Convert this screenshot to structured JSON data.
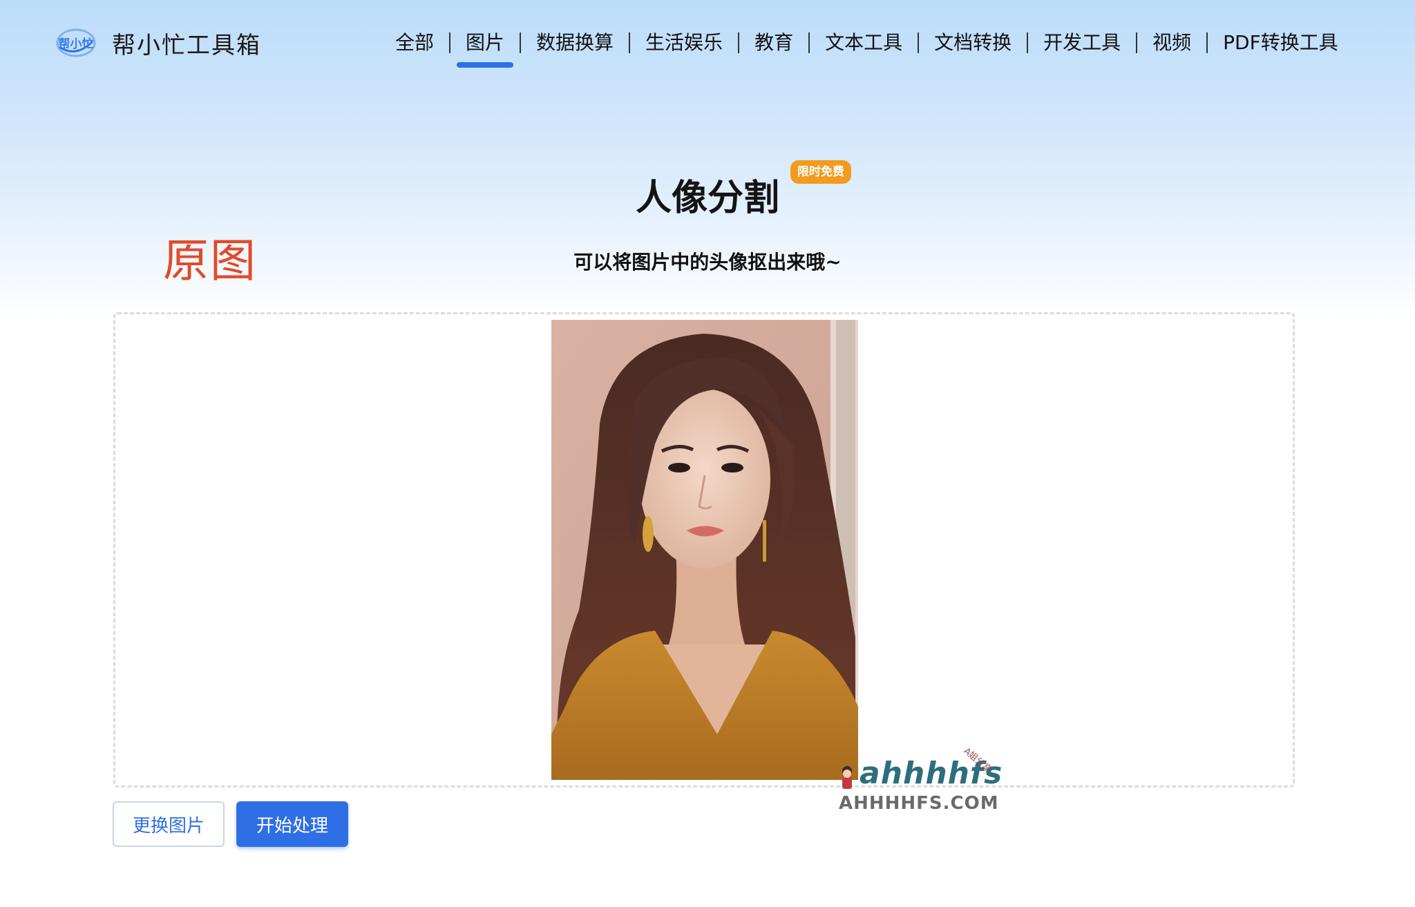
{
  "brand": {
    "logo_text": "帮小忙",
    "name": "帮小忙工具箱"
  },
  "nav": {
    "items": [
      {
        "label": "全部",
        "active": false
      },
      {
        "label": "图片",
        "active": true
      },
      {
        "label": "数据换算",
        "active": false
      },
      {
        "label": "生活娱乐",
        "active": false
      },
      {
        "label": "教育",
        "active": false
      },
      {
        "label": "文本工具",
        "active": false
      },
      {
        "label": "文档转换",
        "active": false
      },
      {
        "label": "开发工具",
        "active": false
      },
      {
        "label": "视频",
        "active": false
      },
      {
        "label": "PDF转换工具",
        "active": false
      }
    ]
  },
  "page": {
    "title": "人像分割",
    "badge": "限时免费",
    "subtitle": "可以将图片中的头像抠出来哦~",
    "overlay_label": "原图"
  },
  "upload": {
    "image_alt": "portrait photo"
  },
  "watermark": {
    "logo": "ahhhhfs",
    "tag": "A姐分享",
    "domain": "AHHHHFS.COM"
  },
  "buttons": {
    "change_image": "更换图片",
    "start_process": "开始处理"
  },
  "colors": {
    "accent": "#2f6fe6",
    "badge": "#f39a1f",
    "overlay_label": "#e24a2a"
  }
}
